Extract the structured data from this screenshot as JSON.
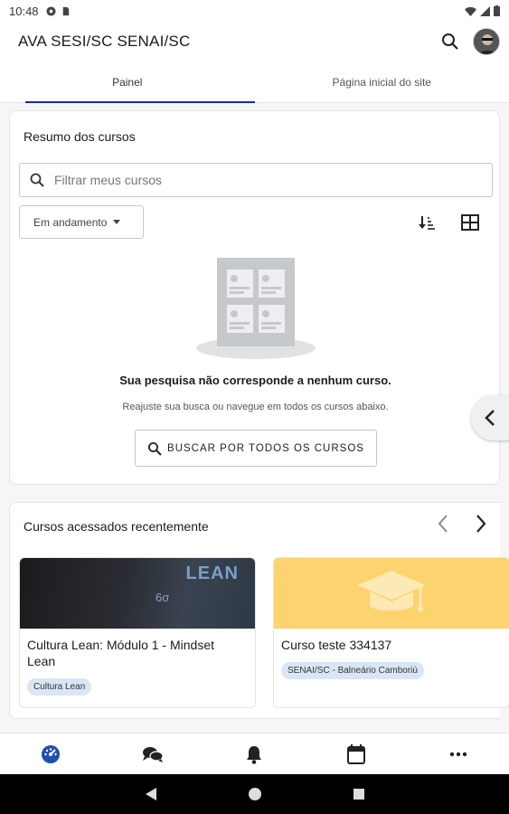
{
  "status_bar": {
    "time": "10:48"
  },
  "app_bar": {
    "title": "AVA SESI/SC SENAI/SC"
  },
  "tabs": [
    {
      "label": "Painel",
      "active": true
    },
    {
      "label": "Página inicial do site",
      "active": false
    }
  ],
  "course_overview": {
    "title": "Resumo dos cursos",
    "search_placeholder": "Filtrar meus cursos",
    "filter_selected": "Em andamento",
    "empty_title": "Sua pesquisa não corresponde a nenhum curso.",
    "empty_subtitle": "Reajuste sua busca ou navegue em todos os cursos abaixo.",
    "browse_button": "BUSCAR POR TODOS OS CURSOS"
  },
  "recent_courses": {
    "title": "Cursos acessados recentemente",
    "items": [
      {
        "name": "Cultura Lean: Módulo 1 - Mindset Lean",
        "category": "Cultura Lean",
        "thumb_text": "LEAN",
        "thumb_symbol": "6σ"
      },
      {
        "name": "Curso teste 334137",
        "category": "SENAI/SC - Balneário Camboriú"
      }
    ]
  },
  "colors": {
    "accent": "#1a2f8a",
    "badge_bg": "#d9e6f6",
    "course_yellow": "#fcd36f",
    "nav_active": "#1f4fa8"
  },
  "icons": {
    "status": [
      "settings-icon",
      "sd-card-icon",
      "wifi-icon",
      "signal-icon",
      "battery-icon"
    ],
    "bottom_nav": [
      "dashboard-icon",
      "messages-icon",
      "notifications-icon",
      "calendar-icon",
      "more-icon"
    ],
    "system_nav": [
      "back-icon",
      "home-icon",
      "recents-icon"
    ]
  }
}
